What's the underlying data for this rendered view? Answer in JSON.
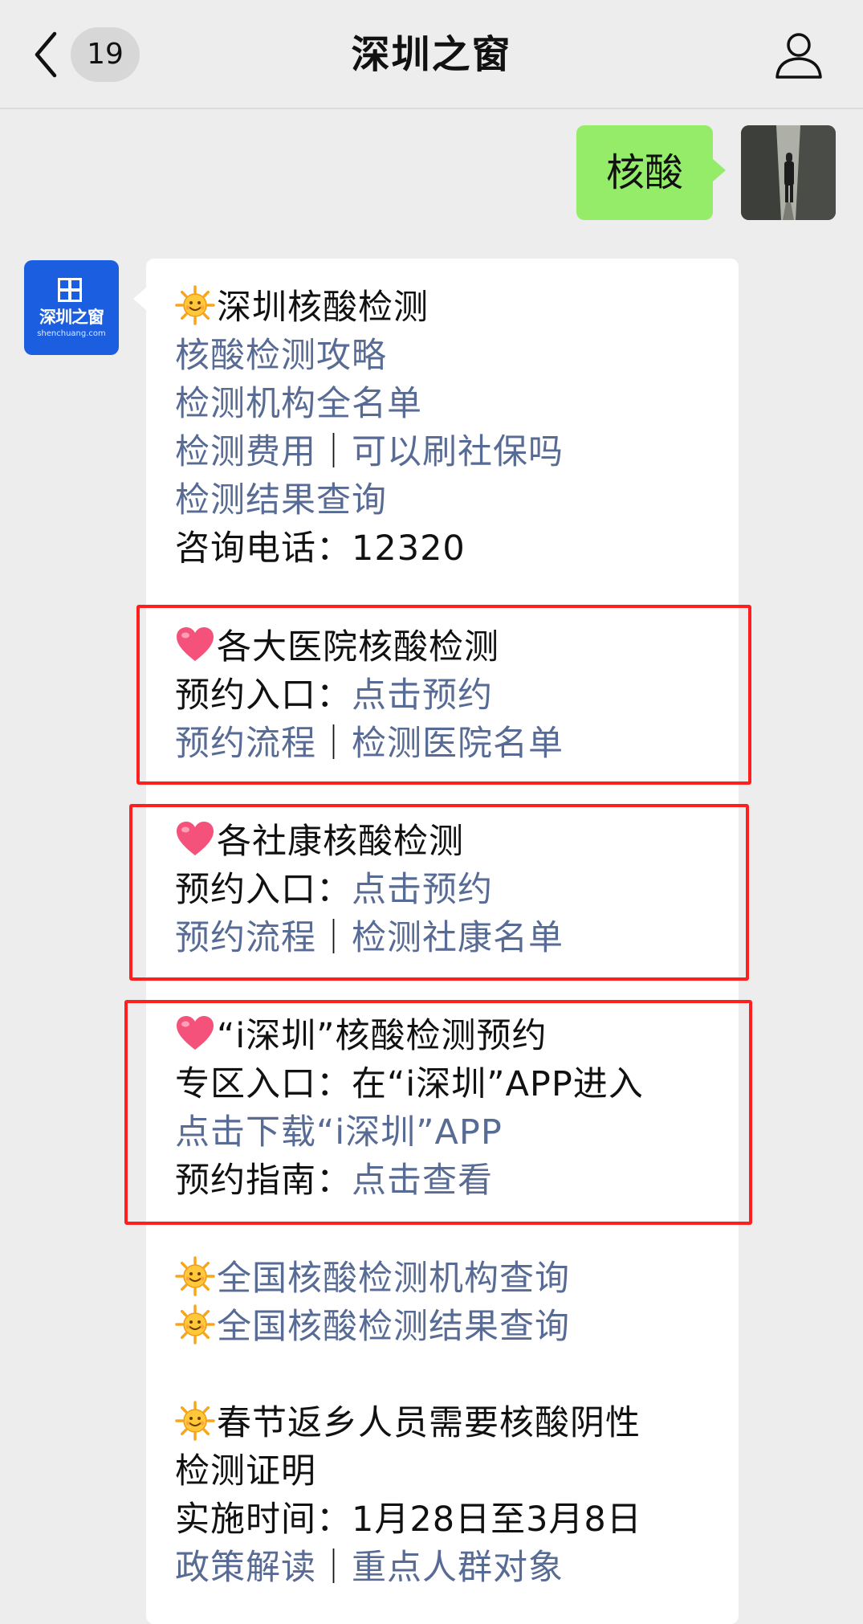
{
  "nav": {
    "unread_count": "19",
    "title": "深圳之窗"
  },
  "outgoing": {
    "text": "核酸"
  },
  "account_avatar": {
    "name": "深圳之窗",
    "url": "shenchuang.com",
    "color": "#1b5fe0"
  },
  "colors": {
    "link": "#576b95",
    "highlight_box": "#ff1f1f",
    "outgoing_bubble": "#95ec69"
  },
  "message": {
    "s1": {
      "icon": "sun-emoji",
      "heading": "深圳核酸检测",
      "link1": "核酸检测攻略",
      "link2": "检测机构全名单",
      "link3a": "检测费用",
      "sep": "｜",
      "link3b": "可以刷社保吗",
      "link4": "检测结果查询",
      "phone": "咨询电话：12320"
    },
    "s2": {
      "icon": "heart-emoji",
      "heading": "各大医院核酸检测",
      "entry_label": "预约入口：",
      "entry_link": "点击预约",
      "flow_link": "预约流程",
      "sep": "｜",
      "list_link": "检测医院名单"
    },
    "s3": {
      "icon": "heart-emoji",
      "heading": "各社康核酸检测",
      "entry_label": "预约入口：",
      "entry_link": "点击预约",
      "flow_link": "预约流程",
      "sep": "｜",
      "list_link": "检测社康名单"
    },
    "s4": {
      "icon": "heart-emoji",
      "heading": "“i深圳”核酸检测预约",
      "zone": "专区入口：在“i深圳”APP进入",
      "download_link": "点击下载“i深圳”APP",
      "guide_label": "预约指南：",
      "guide_link": "点击查看"
    },
    "s5": {
      "link1": "全国核酸检测机构查询",
      "link2": "全国核酸检测结果查询"
    },
    "s6": {
      "heading_line1": "春节返乡人员需要核酸阴性",
      "heading_line2": "检测证明",
      "period": "实施时间：1月28日至3月8日",
      "link_a": "政策解读",
      "sep": "｜",
      "link_b": "重点人群对象"
    }
  }
}
